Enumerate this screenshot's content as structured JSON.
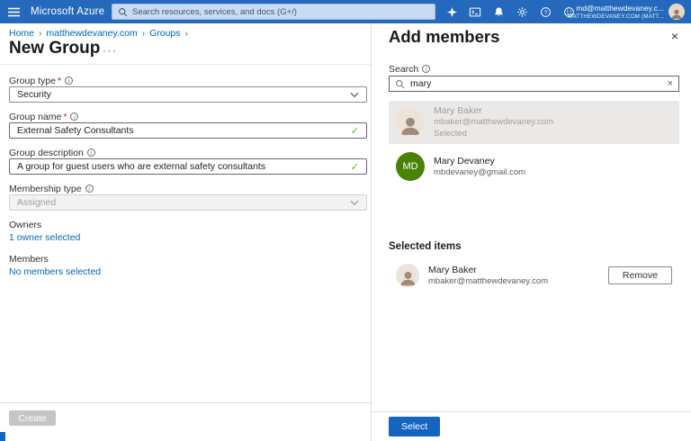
{
  "glyphs": {
    "close": "×",
    "clear": "×",
    "check": "✓",
    "more": "···",
    "separator": "›",
    "required": "*",
    "info": "i",
    "question": "?"
  },
  "header": {
    "brand": "Microsoft Azure",
    "search_placeholder": "Search resources, services, and docs (G+/)",
    "account_email": "md@matthewdevaney.c...",
    "account_tenant": "MATTHEWDEVANEY.COM (MATT...",
    "icons": [
      "copilot",
      "cloud-shell",
      "notifications",
      "settings",
      "help",
      "feedback"
    ]
  },
  "breadcrumb": {
    "items": [
      "Home",
      "matthewdevaney.com",
      "Groups"
    ]
  },
  "page": {
    "title": "New Group"
  },
  "form": {
    "group_type": {
      "label": "Group type",
      "value": "Security"
    },
    "group_name": {
      "label": "Group name",
      "value": "External Safety Consultants"
    },
    "group_description": {
      "label": "Group description",
      "value": "A group for guest users who are external safety consultants"
    },
    "membership_type": {
      "label": "Membership type",
      "value": "Assigned"
    },
    "owners": {
      "label": "Owners",
      "link": "1 owner selected"
    },
    "members": {
      "label": "Members",
      "link": "No members selected"
    },
    "create_label": "Create"
  },
  "panel": {
    "title": "Add members",
    "search_label": "Search",
    "search_value": "mary",
    "results": [
      {
        "name": "Mary Baker",
        "email": "mbaker@matthewdevaney.com",
        "status": "Selected"
      },
      {
        "name": "Mary Devaney",
        "email": "mbdevaney@gmail.com",
        "initials": "MD"
      }
    ],
    "selected_items_label": "Selected items",
    "selected": [
      {
        "name": "Mary Baker",
        "email": "mbaker@matthewdevaney.com"
      }
    ],
    "remove_label": "Remove",
    "select_label": "Select"
  },
  "colors": {
    "header_bg": "#2569bd",
    "accent": "#1565c0",
    "link": "#0067b8",
    "success": "#6bb700",
    "avatar_green": "#498205"
  }
}
